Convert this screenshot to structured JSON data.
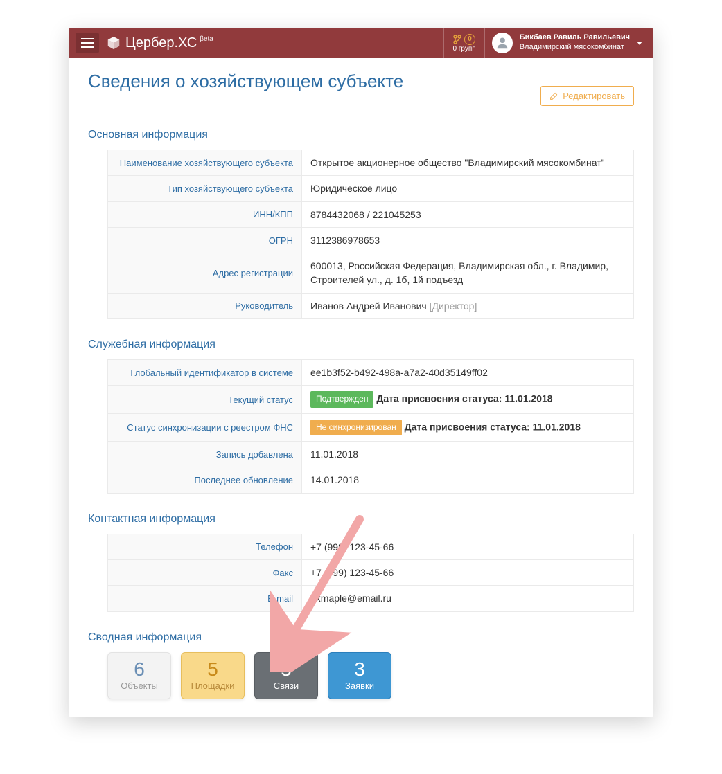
{
  "header": {
    "brand": "Цербер.ХС",
    "beta": "βeta",
    "groups_count": "0",
    "groups_label": "0 групп",
    "user_name": "Бикбаев Равиль Равильевич",
    "user_org": "Владимирский мясокомбинат"
  },
  "page": {
    "title": "Сведения о хозяйствующем субъекте",
    "edit_button": "Редактировать"
  },
  "section_main_title": "Основная информация",
  "main": {
    "row1_label": "Наименование хозяйствующего субъекта",
    "row1_value": "Открытое акционерное общество \"Владимирский мясокомбинат\"",
    "row2_label": "Тип хозяйствующего субъекта",
    "row2_value": "Юридическое лицо",
    "row3_label": "ИНН/КПП",
    "row3_value": "8784432068 / 221045253",
    "row4_label": "ОГРН",
    "row4_value": "3112386978653",
    "row5_label": "Адрес регистрации",
    "row5_value": "600013, Российская Федерация, Владимирская обл., г. Владимир, Строителей ул., д. 1б, 1й подъезд",
    "row6_label": "Руководитель",
    "row6_value_name": "Иванов Андрей Иванович",
    "row6_value_role": "[Директор]"
  },
  "section_service_title": "Служебная информация",
  "service": {
    "row1_label": "Глобальный идентификатор в системе",
    "row1_value": "ee1b3f52-b492-498a-a7a2-40d35149ff02",
    "row2_label": "Текущий статус",
    "row2_badge": "Подтвержден",
    "row2_text": "Дата присвоения статуса: 11.01.2018",
    "row3_label": "Статус синхронизации с реестром ФНС",
    "row3_badge": "Не синхронизирован",
    "row3_text": "Дата присвоения статуса: 11.01.2018",
    "row4_label": "Запись добавлена",
    "row4_value": "11.01.2018",
    "row5_label": "Последнее обновление",
    "row5_value": "14.01.2018"
  },
  "section_contact_title": "Контактная информация",
  "contact": {
    "row1_label": "Телефон",
    "row1_value": "+7 (999) 123-45-66",
    "row2_label": "Факс",
    "row2_value": "+7 (999) 123-45-66",
    "row3_label": "E-mail",
    "row3_value": "exmaple@email.ru"
  },
  "section_summary_title": "Сводная информация",
  "tiles": {
    "t1_num": "6",
    "t1_lab": "Объекты",
    "t2_num": "5",
    "t2_lab": "Площадки",
    "t3_num": "5",
    "t3_lab": "Связи",
    "t4_num": "3",
    "t4_lab": "Заявки"
  }
}
